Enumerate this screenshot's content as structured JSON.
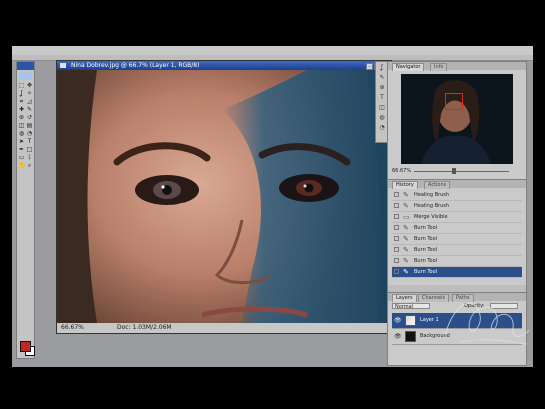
{
  "colors": {
    "accent": "#2a4f8a",
    "titlebar": "#1e3f8c",
    "foreground_swatch": "#c2261e",
    "background_swatch": "#ffffff",
    "navigator_frame": "#e0271d",
    "panel_bg": "#cacaca",
    "workspace_bg": "#9a9c9f"
  },
  "toolbox": {
    "tool_icons": [
      "marquee-icon",
      "move-icon",
      "lasso-icon",
      "magic-wand-icon",
      "crop-icon",
      "slice-icon",
      "healing-brush-icon",
      "brush-icon",
      "clone-stamp-icon",
      "history-brush-icon",
      "eraser-icon",
      "gradient-icon",
      "blur-icon",
      "dodge-icon",
      "path-select-icon",
      "type-icon",
      "pen-icon",
      "shape-icon",
      "notes-icon",
      "eyedropper-icon",
      "hand-icon",
      "zoom-icon"
    ],
    "tool_glyphs": [
      "⬚",
      "✥",
      "ʆ",
      "✧",
      "⌗",
      "◿",
      "✚",
      "✎",
      "⊛",
      "↺",
      "◫",
      "▤",
      "◍",
      "◔",
      "➤",
      "T",
      "✒",
      "□",
      "▭",
      "⟟",
      "✋",
      "⌕"
    ]
  },
  "document": {
    "title": "Nina Dobrev.jpg @ 66.7% (Layer 1, RGB/8)",
    "zoom": "66.67%",
    "status_info": "Doc: 1.03M/2.06M",
    "window_controls": [
      "–",
      "□",
      "×"
    ]
  },
  "navigator": {
    "tabs": [
      "Navigator",
      "Info"
    ],
    "zoom_value": "66.67%"
  },
  "history": {
    "tabs": [
      "History",
      "Actions"
    ],
    "items": [
      {
        "icon": "brush-icon",
        "glyph": "✎",
        "label": "Healing Brush"
      },
      {
        "icon": "brush-icon",
        "glyph": "✎",
        "label": "Healing Brush"
      },
      {
        "icon": "layer-icon",
        "glyph": "▭",
        "label": "Merge Visible"
      },
      {
        "icon": "brush-icon",
        "glyph": "✎",
        "label": "Burn Tool"
      },
      {
        "icon": "brush-icon",
        "glyph": "✎",
        "label": "Burn Tool"
      },
      {
        "icon": "brush-icon",
        "glyph": "✎",
        "label": "Burn Tool"
      },
      {
        "icon": "brush-icon",
        "glyph": "✎",
        "label": "Burn Tool"
      },
      {
        "icon": "brush-icon",
        "glyph": "✎",
        "label": "Burn Tool"
      }
    ],
    "selected_index": 7
  },
  "layers": {
    "tabs": [
      "Layers",
      "Channels",
      "Paths"
    ],
    "blend_mode": "Normal",
    "opacity_label": "Opacity:",
    "rows": [
      {
        "name": "Layer 1",
        "eye": "👁",
        "selected": true
      },
      {
        "name": "Background",
        "eye": "👁",
        "selected": false
      }
    ]
  }
}
